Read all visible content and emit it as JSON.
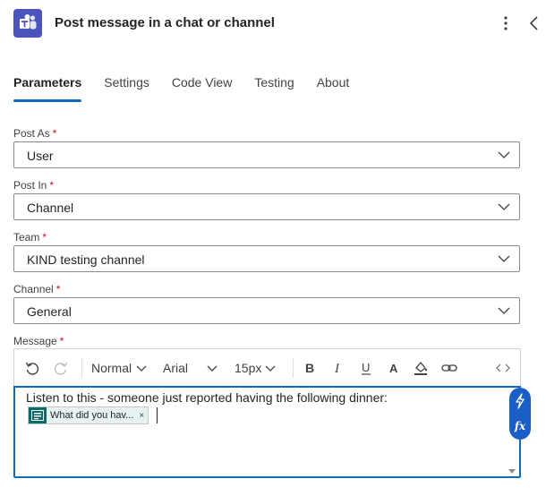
{
  "header": {
    "title": "Post message in a chat or channel",
    "icon": "teams-icon",
    "brand_color": "#4b53bc"
  },
  "tabs": [
    {
      "label": "Parameters",
      "active": true
    },
    {
      "label": "Settings",
      "active": false
    },
    {
      "label": "Code View",
      "active": false
    },
    {
      "label": "Testing",
      "active": false
    },
    {
      "label": "About",
      "active": false
    }
  ],
  "fields": {
    "post_as": {
      "label": "Post As",
      "required_mark": "*",
      "value": "User"
    },
    "post_in": {
      "label": "Post In",
      "required_mark": "*",
      "value": "Channel"
    },
    "team": {
      "label": "Team",
      "required_mark": "*",
      "value": "KIND testing channel"
    },
    "channel": {
      "label": "Channel",
      "required_mark": "*",
      "value": "General"
    },
    "message": {
      "label": "Message",
      "required_mark": "*"
    }
  },
  "editor": {
    "paragraph_style": "Normal",
    "font": "Arial",
    "font_size": "15px",
    "text": "Listen to this - someone just reported having the following dinner:",
    "token": {
      "label": "What did you hav...",
      "remove": "×",
      "icon": "forms-icon"
    },
    "side_buttons": {
      "fx_label": "fx"
    }
  },
  "colors": {
    "accent": "#0f6cbd",
    "required": "#c50f1f",
    "side_action_bg": "#1b5fc6",
    "token_bg": "#e6f2f2"
  }
}
